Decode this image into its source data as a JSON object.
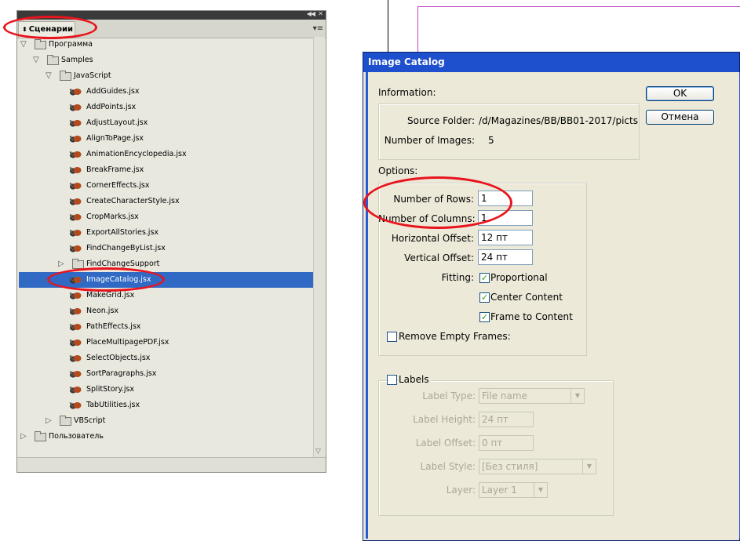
{
  "panel": {
    "tab_label": "Сценарии",
    "tree": [
      {
        "label": "Программа",
        "type": "folder",
        "depth": 0,
        "expanded": true
      },
      {
        "label": "Samples",
        "type": "folder",
        "depth": 1,
        "expanded": true
      },
      {
        "label": "JavaScript",
        "type": "folder",
        "depth": 2,
        "expanded": true
      },
      {
        "label": "AddGuides.jsx",
        "type": "script",
        "depth": 3
      },
      {
        "label": "AddPoints.jsx",
        "type": "script",
        "depth": 3
      },
      {
        "label": "AdjustLayout.jsx",
        "type": "script",
        "depth": 3
      },
      {
        "label": "AlignToPage.jsx",
        "type": "script",
        "depth": 3
      },
      {
        "label": "AnimationEncyclopedia.jsx",
        "type": "script",
        "depth": 3
      },
      {
        "label": "BreakFrame.jsx",
        "type": "script",
        "depth": 3
      },
      {
        "label": "CornerEffects.jsx",
        "type": "script",
        "depth": 3
      },
      {
        "label": "CreateCharacterStyle.jsx",
        "type": "script",
        "depth": 3
      },
      {
        "label": "CropMarks.jsx",
        "type": "script",
        "depth": 3
      },
      {
        "label": "ExportAllStories.jsx",
        "type": "script",
        "depth": 3
      },
      {
        "label": "FindChangeByList.jsx",
        "type": "script",
        "depth": 3
      },
      {
        "label": "FindChangeSupport",
        "type": "folder",
        "depth": 3,
        "expanded": false
      },
      {
        "label": "ImageCatalog.jsx",
        "type": "script",
        "depth": 3,
        "selected": true
      },
      {
        "label": "MakeGrid.jsx",
        "type": "script",
        "depth": 3
      },
      {
        "label": "Neon.jsx",
        "type": "script",
        "depth": 3
      },
      {
        "label": "PathEffects.jsx",
        "type": "script",
        "depth": 3
      },
      {
        "label": "PlaceMultipagePDF.jsx",
        "type": "script",
        "depth": 3
      },
      {
        "label": "SelectObjects.jsx",
        "type": "script",
        "depth": 3
      },
      {
        "label": "SortParagraphs.jsx",
        "type": "script",
        "depth": 3
      },
      {
        "label": "SplitStory.jsx",
        "type": "script",
        "depth": 3
      },
      {
        "label": "TabUtilities.jsx",
        "type": "script",
        "depth": 3
      },
      {
        "label": "VBScript",
        "type": "folder",
        "depth": 2,
        "expanded": false
      },
      {
        "label": "Пользователь",
        "type": "folder",
        "depth": 0,
        "expanded": false
      }
    ]
  },
  "dialog": {
    "title": "Image Catalog",
    "ok_label": "OK",
    "cancel_label": "Отмена",
    "information": {
      "heading": "Information:",
      "source_folder_label": "Source Folder:",
      "source_folder_value": "/d/Magazines/BB/BB01-2017/picts",
      "num_images_label": "Number of Images:",
      "num_images_value": "5"
    },
    "options": {
      "heading": "Options:",
      "rows_label": "Number of Rows:",
      "rows_value": "1",
      "cols_label": "Number of Columns:",
      "cols_value": "1",
      "hoffset_label": "Horizontal Offset:",
      "hoffset_value": "12 пт",
      "voffset_label": "Vertical Offset:",
      "voffset_value": "24 пт",
      "fitting_label": "Fitting:",
      "proportional_label": "Proportional",
      "proportional_checked": true,
      "center_label": "Center Content",
      "center_checked": true,
      "frame_label": "Frame to Content",
      "frame_checked": true,
      "remove_empty_label": "Remove Empty Frames:",
      "remove_empty_checked": false
    },
    "labels": {
      "heading": "Labels",
      "checked": false,
      "type_label": "Label Type:",
      "type_value": "File name",
      "height_label": "Label Height:",
      "height_value": "24 пт",
      "offset_label": "Label Offset:",
      "offset_value": "0 пт",
      "style_label": "Label Style:",
      "style_value": "[Без стиля]",
      "layer_label": "Layer:",
      "layer_value": "Layer 1"
    }
  },
  "colors": {
    "annotation_red": "#e8141e",
    "selection_blue": "#316ac5",
    "dialog_titlebar": "#1e4fcc",
    "guide_magenta": "#c040c0"
  }
}
